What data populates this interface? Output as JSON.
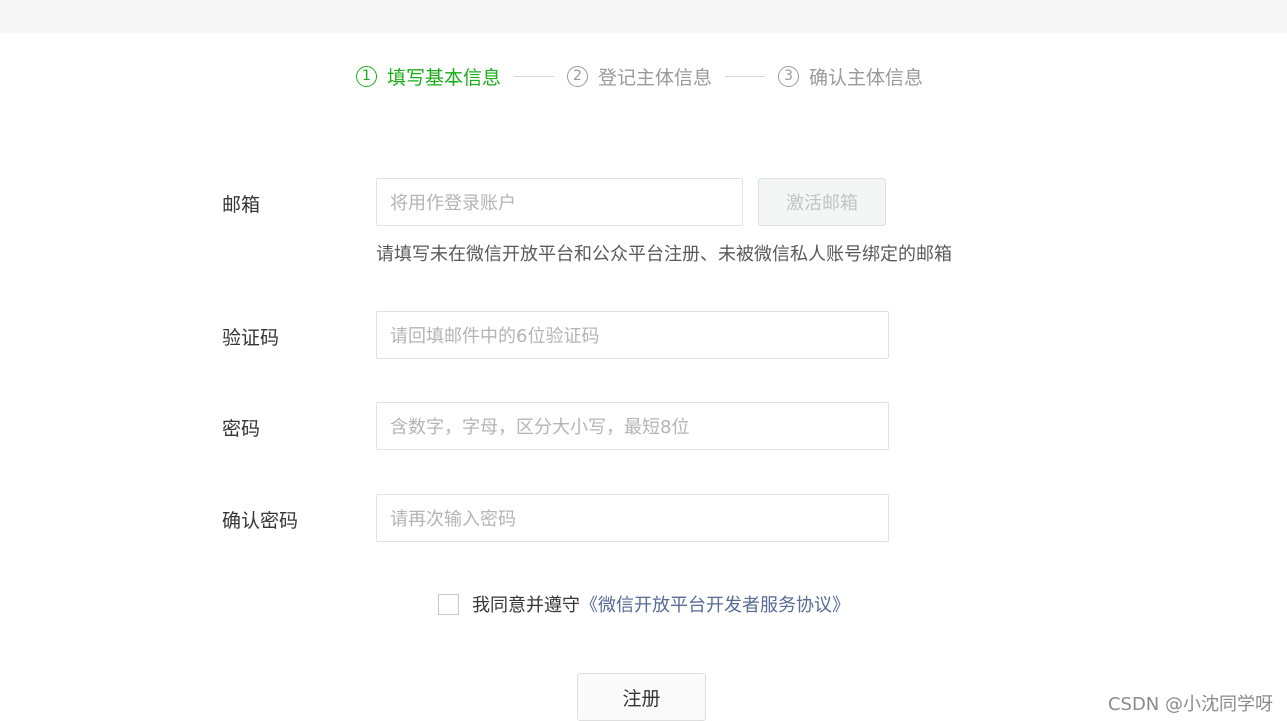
{
  "steps": [
    {
      "num": "1",
      "label": "填写基本信息",
      "active": true
    },
    {
      "num": "2",
      "label": "登记主体信息",
      "active": false
    },
    {
      "num": "3",
      "label": "确认主体信息",
      "active": false
    }
  ],
  "form": {
    "email": {
      "label": "邮箱",
      "placeholder": "将用作登录账户",
      "activate_label": "激活邮箱",
      "hint": "请填写未在微信开放平台和公众平台注册、未被微信私人账号绑定的邮箱"
    },
    "code": {
      "label": "验证码",
      "placeholder": "请回填邮件中的6位验证码"
    },
    "password": {
      "label": "密码",
      "placeholder": "含数字，字母，区分大小写，最短8位"
    },
    "confirm": {
      "label": "确认密码",
      "placeholder": "请再次输入密码"
    }
  },
  "agreement": {
    "text": "我同意并遵守",
    "link": "《微信开放平台开发者服务协议》",
    "checked": false
  },
  "register_label": "注册",
  "watermark": "CSDN @小沈同学呀",
  "colors": {
    "accent": "#1aad19",
    "link": "#576b95"
  }
}
